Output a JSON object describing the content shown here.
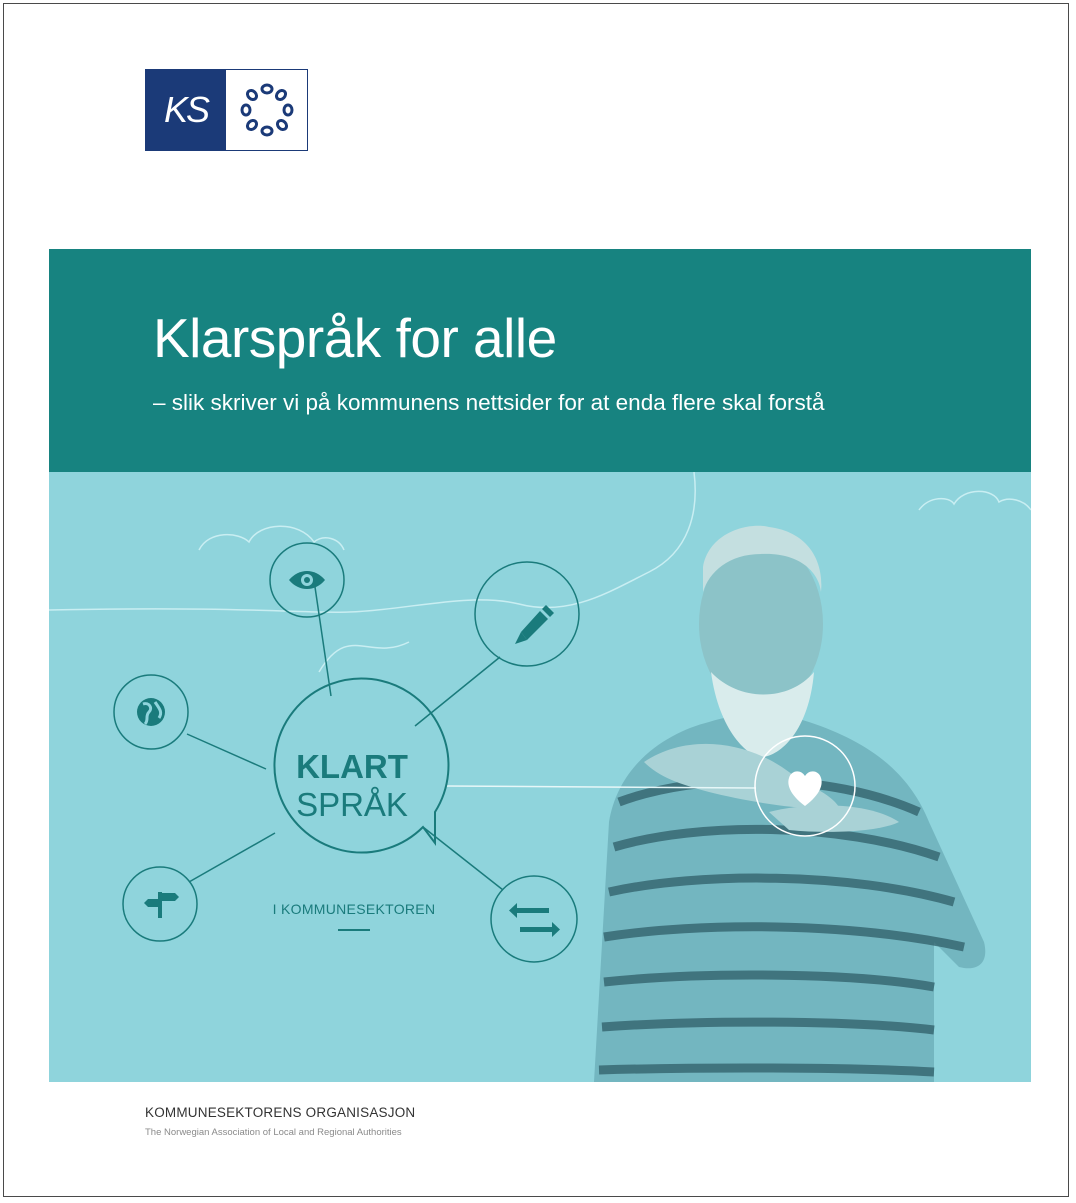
{
  "logo": {
    "text": "KS"
  },
  "cover": {
    "title": "Klarspråk for alle",
    "subtitle": "– slik skriver vi på kommunens nettsider for at enda flere skal forstå"
  },
  "illustration": {
    "badge_line1": "KLART",
    "badge_line2": "SPRÅK",
    "badge_caption": "I KOMMUNESEKTOREN",
    "icons": [
      "eye-icon",
      "pencil-icon",
      "globe-icon",
      "signpost-icon",
      "arrows-icon",
      "heart-icon"
    ]
  },
  "footer": {
    "org_name": "KOMMUNESEKTORENS ORGANISASJON",
    "org_name_en": "The Norwegian Association of Local and Regional Authorities"
  },
  "colors": {
    "brand_blue": "#1b3a78",
    "band_teal": "#178380",
    "illustration_bg": "#8fd4dc",
    "line_teal": "#1a7b7c"
  }
}
